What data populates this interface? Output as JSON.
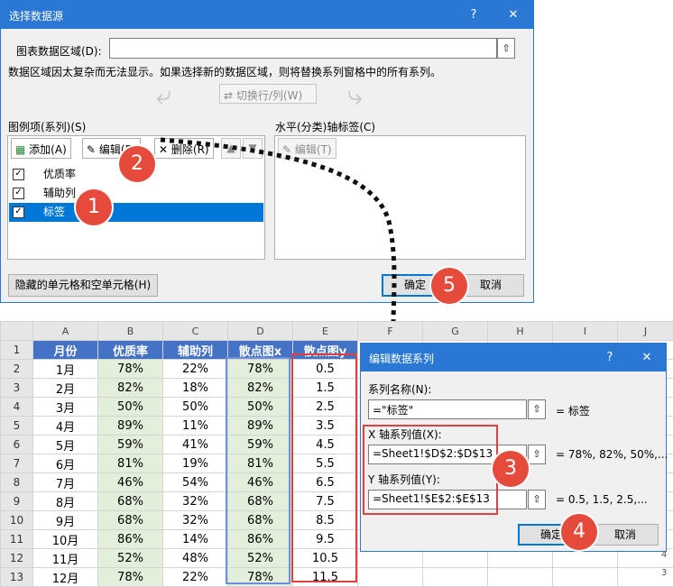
{
  "select_dialog": {
    "title": "选择数据源",
    "help": "?",
    "close": "✕",
    "range_label": "图表数据区域(D):",
    "range_value": "",
    "notice": "数据区域因太复杂而无法显示。如果选择新的数据区域，则将替换系列窗格中的所有系列。",
    "switch_btn": "切换行/列(W)",
    "legend_label": "图例项(系列)(S)",
    "add_btn": "添加(A)",
    "edit_btn": "编辑(E)",
    "delete_btn": "删除(R)",
    "series": [
      {
        "name": "优质率",
        "checked": true
      },
      {
        "name": "辅助列",
        "checked": true
      },
      {
        "name": "标签",
        "checked": true
      }
    ],
    "axis_label": "水平(分类)轴标签(C)",
    "axis_edit_btn": "编辑(T)",
    "hidden_btn": "隐藏的单元格和空单元格(H)",
    "ok": "确定",
    "cancel": "取消"
  },
  "sheet": {
    "col_letters": [
      "A",
      "B",
      "C",
      "D",
      "E",
      "F",
      "G",
      "H",
      "I",
      "J"
    ],
    "headers": [
      "月份",
      "优质率",
      "辅助列",
      "散点图x",
      "散点图y"
    ],
    "rows": [
      [
        "1月",
        "78%",
        "22%",
        "78%",
        "0.5"
      ],
      [
        "2月",
        "82%",
        "18%",
        "82%",
        "1.5"
      ],
      [
        "3月",
        "50%",
        "50%",
        "50%",
        "2.5"
      ],
      [
        "4月",
        "89%",
        "11%",
        "89%",
        "3.5"
      ],
      [
        "5月",
        "59%",
        "41%",
        "59%",
        "4.5"
      ],
      [
        "6月",
        "81%",
        "19%",
        "81%",
        "5.5"
      ],
      [
        "7月",
        "46%",
        "54%",
        "46%",
        "6.5"
      ],
      [
        "8月",
        "68%",
        "32%",
        "68%",
        "7.5"
      ],
      [
        "9月",
        "68%",
        "32%",
        "68%",
        "8.5"
      ],
      [
        "10月",
        "86%",
        "14%",
        "86%",
        "9.5"
      ],
      [
        "11月",
        "52%",
        "48%",
        "52%",
        "10.5"
      ],
      [
        "12月",
        "78%",
        "22%",
        "78%",
        "11.5"
      ]
    ],
    "row_numbers": [
      "1",
      "2",
      "3",
      "4",
      "5",
      "6",
      "7",
      "8",
      "9",
      "10",
      "11",
      "12",
      "13"
    ],
    "edge_numbers": [
      "4",
      "3"
    ]
  },
  "edit_dialog": {
    "title": "编辑数据系列",
    "help": "?",
    "close": "✕",
    "name_label": "系列名称(N):",
    "name_value": "=\"标签\"",
    "name_preview": "= 标签",
    "x_label": "X 轴系列值(X):",
    "x_value": "=Sheet1!$D$2:$D$13",
    "x_preview": "= 78%, 82%, 50%,...",
    "y_label": "Y 轴系列值(Y):",
    "y_value": "=Sheet1!$E$2:$E$13",
    "y_preview": "= 0.5, 1.5, 2.5,...",
    "ok": "确定",
    "cancel": "取消"
  },
  "badges": [
    "1",
    "2",
    "3",
    "4",
    "5"
  ],
  "colors": {
    "accent": "#2b78d4",
    "badge": "#e64a3b",
    "header_fill": "#4472c4",
    "green_fill": "#e2efda",
    "highlight": "#e04040"
  }
}
